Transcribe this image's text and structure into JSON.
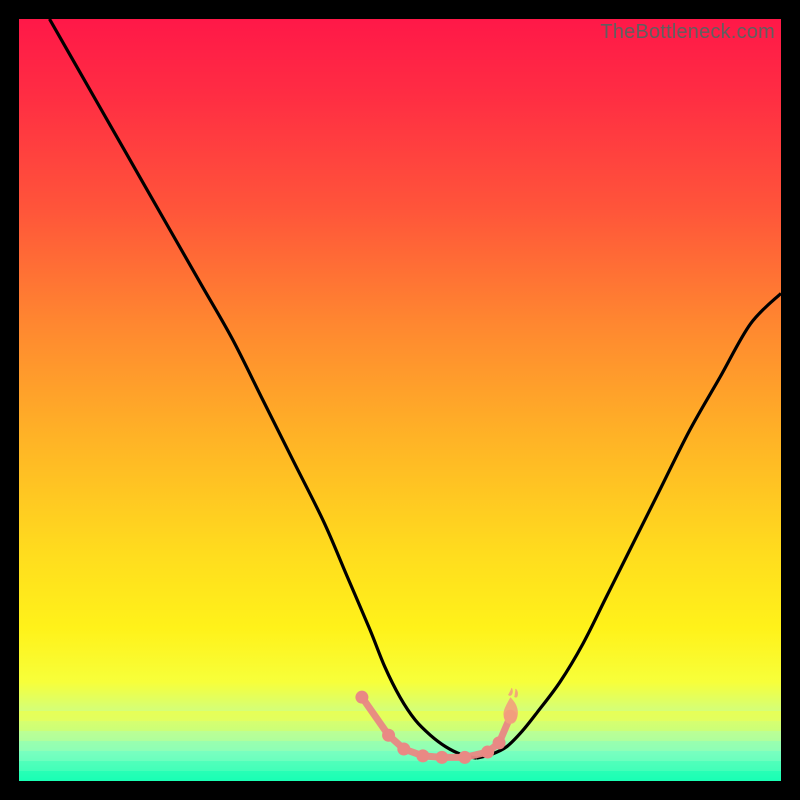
{
  "watermark": "TheBottleneck.com",
  "colors": {
    "gradient_stops": [
      {
        "offset": 0.0,
        "color": "#ff1848"
      },
      {
        "offset": 0.1,
        "color": "#ff2d43"
      },
      {
        "offset": 0.25,
        "color": "#ff553a"
      },
      {
        "offset": 0.4,
        "color": "#ff8730"
      },
      {
        "offset": 0.55,
        "color": "#ffb326"
      },
      {
        "offset": 0.7,
        "color": "#ffdc1e"
      },
      {
        "offset": 0.8,
        "color": "#fff21a"
      },
      {
        "offset": 0.87,
        "color": "#f7ff3a"
      },
      {
        "offset": 0.92,
        "color": "#c8ff8d"
      },
      {
        "offset": 0.96,
        "color": "#7affc0"
      },
      {
        "offset": 1.0,
        "color": "#19ffb4"
      }
    ],
    "curve": "#000000",
    "marker_fill": "#e98984",
    "marker_stroke": "#e98984",
    "flame": "#f3a07d"
  },
  "chart_data": {
    "type": "line",
    "title": "",
    "xlabel": "",
    "ylabel": "",
    "xlim": [
      0,
      100
    ],
    "ylim": [
      0,
      100
    ],
    "grid": false,
    "curve_left": {
      "x": [
        4,
        8,
        12,
        16,
        20,
        24,
        28,
        32,
        36,
        40,
        43,
        46,
        48,
        50,
        52,
        54,
        56,
        58,
        60
      ],
      "y": [
        100,
        93,
        86,
        79,
        72,
        65,
        58,
        50,
        42,
        34,
        27,
        20,
        15,
        11,
        8,
        6,
        4.5,
        3.5,
        3
      ]
    },
    "curve_right": {
      "x": [
        60,
        62,
        64,
        66,
        68,
        71,
        74,
        77,
        80,
        84,
        88,
        92,
        96,
        100
      ],
      "y": [
        3,
        3.5,
        4.5,
        6.5,
        9,
        13,
        18,
        24,
        30,
        38,
        46,
        53,
        60,
        64
      ]
    },
    "markers": {
      "x": [
        45.0,
        48.5,
        50.5,
        53.0,
        55.5,
        58.5,
        61.5,
        63.0,
        64.5
      ],
      "y": [
        11.0,
        6.0,
        4.2,
        3.3,
        3.1,
        3.1,
        3.8,
        5.0,
        8.5
      ]
    },
    "flame_marker": {
      "x": 64.5,
      "y": 8.5
    }
  }
}
